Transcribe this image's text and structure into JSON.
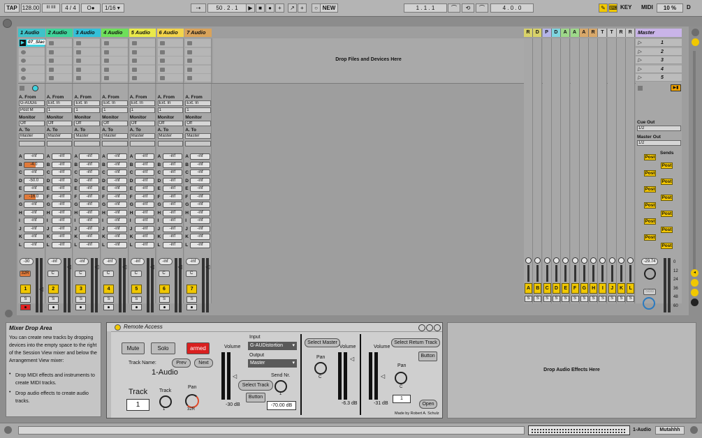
{
  "transport": {
    "tap": "TAP",
    "tempo": "128.00",
    "tempo_nudge": "III  IIII",
    "signature": "4 / 4",
    "metronome": "O●",
    "quantize": "1/16",
    "position": "50 .   2 .   1",
    "new_label": "NEW",
    "loop_start": "1 .   1 .   1",
    "loop_length": "4 .   0 .   0",
    "key_label": "KEY",
    "midi_label": "MIDI",
    "cpu": "10 %",
    "d_label": "D"
  },
  "tracks": [
    {
      "name": "1 Audio",
      "color": "#3fc2c9",
      "clip": "07_Slac",
      "from": "G-AUDis",
      "chan": "Post M",
      "monitor": "Off",
      "to": "Master",
      "sends": [
        "-inf",
        "-4.0",
        "-inf",
        "-50.0",
        "-inf",
        "-16.0",
        "-inf",
        "-inf",
        "-inf",
        "-inf",
        "-inf",
        "-inf"
      ],
      "hl": [
        false,
        true,
        false,
        false,
        false,
        true,
        false,
        false,
        false,
        false,
        false,
        false
      ],
      "vol": "-30",
      "pan": "32R",
      "num": "1",
      "armed": true
    },
    {
      "name": "2 Audio",
      "color": "#3fd39a",
      "clip": "",
      "from": "Ext. In",
      "chan": "1",
      "monitor": "Off",
      "to": "Master",
      "sends": [
        "-inf",
        "-inf",
        "-inf",
        "-inf",
        "-inf",
        "-inf",
        "-inf",
        "-inf",
        "-inf",
        "-inf",
        "-inf",
        "-inf"
      ],
      "hl": [
        false,
        false,
        false,
        false,
        false,
        false,
        false,
        false,
        false,
        false,
        false,
        false
      ],
      "vol": "-inf",
      "pan": "C",
      "num": "2",
      "armed": false
    },
    {
      "name": "3 Audio",
      "color": "#34c0d8",
      "clip": "",
      "from": "Ext. In",
      "chan": "1",
      "monitor": "Off",
      "to": "Master",
      "sends": [
        "-inf",
        "-inf",
        "-inf",
        "-inf",
        "-inf",
        "-inf",
        "-inf",
        "-inf",
        "-inf",
        "-inf",
        "-inf",
        "-inf"
      ],
      "hl": [
        false,
        false,
        false,
        false,
        false,
        false,
        false,
        false,
        false,
        false,
        false,
        false
      ],
      "vol": "-inf",
      "pan": "C",
      "num": "3",
      "armed": false
    },
    {
      "name": "4 Audio",
      "color": "#6ee05a",
      "clip": "",
      "from": "Ext. In",
      "chan": "1",
      "monitor": "Off",
      "to": "Master",
      "sends": [
        "-inf",
        "-inf",
        "-inf",
        "-inf",
        "-inf",
        "-inf",
        "-inf",
        "-inf",
        "-inf",
        "-inf",
        "-inf",
        "-inf"
      ],
      "hl": [
        false,
        false,
        false,
        false,
        false,
        false,
        false,
        false,
        false,
        false,
        false,
        false
      ],
      "vol": "-inf",
      "pan": "C",
      "num": "4",
      "armed": false
    },
    {
      "name": "5 Audio",
      "color": "#e9e94a",
      "clip": "",
      "from": "Ext. In",
      "chan": "1",
      "monitor": "Off",
      "to": "Master",
      "sends": [
        "-inf",
        "-inf",
        "-inf",
        "-inf",
        "-inf",
        "-inf",
        "-inf",
        "-inf",
        "-inf",
        "-inf",
        "-inf",
        "-inf"
      ],
      "hl": [
        false,
        false,
        false,
        false,
        false,
        false,
        false,
        false,
        false,
        false,
        false,
        false
      ],
      "vol": "-inf",
      "pan": "C",
      "num": "5",
      "armed": false
    },
    {
      "name": "6 Audio",
      "color": "#f3d44a",
      "clip": "",
      "from": "Ext. In",
      "chan": "1",
      "monitor": "Off",
      "to": "Master",
      "sends": [
        "-inf",
        "-inf",
        "-inf",
        "-inf",
        "-inf",
        "-inf",
        "-inf",
        "-inf",
        "-inf",
        "-inf",
        "-inf",
        "-inf"
      ],
      "hl": [
        false,
        false,
        false,
        false,
        false,
        false,
        false,
        false,
        false,
        false,
        false,
        false
      ],
      "vol": "-inf",
      "pan": "C",
      "num": "6",
      "armed": false
    },
    {
      "name": "7 Audio",
      "color": "#d9a35a",
      "clip": "",
      "from": "Ext. In",
      "chan": "1",
      "monitor": "Off",
      "to": "Master",
      "sends": [
        "-inf",
        "-inf",
        "-inf",
        "-inf",
        "-inf",
        "-inf",
        "-inf",
        "-inf",
        "-inf",
        "-inf",
        "-inf",
        "-inf"
      ],
      "hl": [
        false,
        false,
        false,
        false,
        false,
        false,
        false,
        false,
        false,
        false,
        false,
        false
      ],
      "vol": "-inf",
      "pan": "C",
      "num": "7",
      "armed": false
    }
  ],
  "io_labels": {
    "from": "A. From",
    "monitor": "Monitor",
    "to": "A. To"
  },
  "send_letters": [
    "A",
    "B",
    "C",
    "D",
    "E",
    "F",
    "G",
    "H",
    "I",
    "J",
    "K",
    "L"
  ],
  "session": {
    "drop_files": "Drop Files and Devices Here"
  },
  "returns": {
    "headers": [
      {
        "letter": "R",
        "color": "#d8d26a"
      },
      {
        "letter": "D",
        "color": "#d8d26a"
      },
      {
        "letter": "P",
        "color": "#b5b5e8"
      },
      {
        "letter": "D",
        "color": "#7fd5e0"
      },
      {
        "letter": "A",
        "color": "#9ed88a"
      },
      {
        "letter": "A",
        "color": "#9ed88a"
      },
      {
        "letter": "A",
        "color": "#d8a86a"
      },
      {
        "letter": "R",
        "color": "#d8a86a"
      },
      {
        "letter": "T",
        "color": "#c9c9c9"
      },
      {
        "letter": "T",
        "color": "#c9c9c9"
      },
      {
        "letter": "R",
        "color": "#c9c9c9"
      },
      {
        "letter": "R",
        "color": "#c9c9c9"
      }
    ],
    "buttons": [
      "A",
      "B",
      "C",
      "D",
      "E",
      "F",
      "G",
      "H",
      "I",
      "J",
      "K",
      "L"
    ],
    "solo": "S"
  },
  "master": {
    "name": "Master",
    "scenes": [
      "1",
      "2",
      "3",
      "4",
      "5"
    ],
    "cue_out_label": "Cue Out",
    "cue_out": "1/2",
    "master_out_label": "Master Out",
    "master_out": "1/2",
    "sends_label": "Sends",
    "post": "Post",
    "volume": "-29.74",
    "solo_label": "Solo",
    "scale": [
      "0",
      "12",
      "24",
      "36",
      "48",
      "60"
    ]
  },
  "info": {
    "title": "Mixer Drop Area",
    "body": "You can create new tracks by dropping devices into the empty space to the right of the Session View mixer and below the Arrangement View mixer:",
    "bullets": [
      "Drop MIDI effects and instruments to create MIDI tracks.",
      "Drop audio effects to create audio tracks."
    ]
  },
  "device": {
    "title": "Remote Access",
    "mute": "Mute",
    "solo": "Solo",
    "armed": "armed",
    "track_name_label": "Track Name:",
    "prev": "Prev",
    "next": "Next",
    "track_name": "1-Audio",
    "track_label": "Track",
    "track_num": "1",
    "track_knob_label": "Track",
    "track_knob_value": "1",
    "pan_label": "Pan",
    "pan_value": "32R",
    "volume_label": "Volume",
    "volume_value": "-30 dB",
    "input_label": "Input",
    "input_value": "G-AUDistortion",
    "output_label": "Output",
    "output_value": "Master",
    "select_track": "Select Track",
    "button": "Button",
    "send_nr_label": "Send Nr.",
    "send_nr_value": "1",
    "send_db": "-70.00 dB",
    "select_master": "Select Master",
    "master_volume_label": "Volume",
    "master_pan_label": "Pan",
    "master_pan_value": "C",
    "master_db": "-6.3 dB",
    "return_volume_label": "Volume",
    "return_db": "-31 dB",
    "select_return": "Select Return Track",
    "return_button": "Button",
    "return_pan_label": "Pan",
    "return_pan_value": "C",
    "return_num": "1",
    "open": "Open",
    "credit": "Made by Robert A. Schulz"
  },
  "drop_fx": "Drop Audio Effects Here",
  "status": {
    "track": "1-Audio",
    "device": "Mutahhh"
  }
}
